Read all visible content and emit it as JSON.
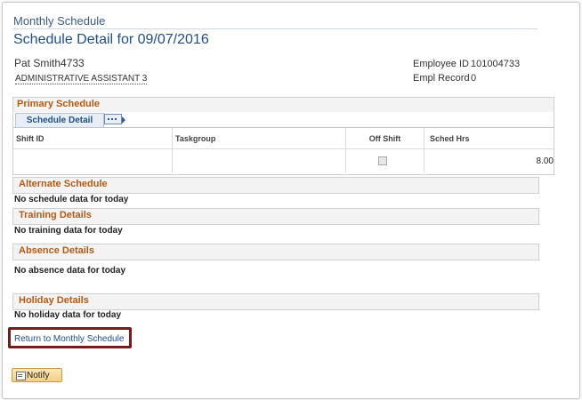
{
  "breadcrumb": "Monthly Schedule",
  "page_title": "Schedule Detail for 09/07/2016",
  "employee": {
    "name": "Pat Smith4733",
    "job_title": "ADMINISTRATIVE ASSISTANT 3",
    "id_label": "Employee ID",
    "id_value": "101004733",
    "record_label": "Empl Record",
    "record_value": "0"
  },
  "primary": {
    "title": "Primary Schedule",
    "tab_label": "Schedule Detail",
    "columns": [
      "Shift ID",
      "Taskgroup",
      "Off Shift",
      "Sched Hrs"
    ],
    "row": {
      "shift_id": "",
      "taskgroup": "",
      "off_shift": false,
      "sched_hrs": "8.00"
    }
  },
  "sections": {
    "alternate": {
      "title": "Alternate Schedule",
      "message": "No schedule data for today"
    },
    "training": {
      "title": "Training Details",
      "message": "No training data for today"
    },
    "absence": {
      "title": "Absence Details",
      "message": "No absence data for today"
    },
    "holiday": {
      "title": "Holiday Details",
      "message": "No holiday data for today"
    }
  },
  "links": {
    "return": "Return to Monthly Schedule"
  },
  "buttons": {
    "notify": "Notify"
  },
  "colors": {
    "accent": "#b85a12",
    "link": "#1f4e8c",
    "highlight": "#7b1a1a"
  }
}
